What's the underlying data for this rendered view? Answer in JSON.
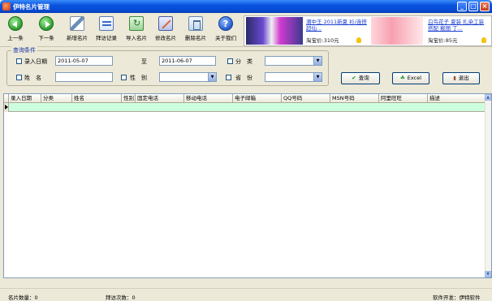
{
  "window": {
    "title": "伊特名片管理"
  },
  "toolbar": {
    "buttons": [
      {
        "label": "上一条",
        "icon": "arrow-left-icon"
      },
      {
        "label": "下一条",
        "icon": "arrow-right-icon"
      },
      {
        "label": "新增名片",
        "icon": "add-card-icon"
      },
      {
        "label": "拜访记录",
        "icon": "visit-record-icon"
      },
      {
        "label": "导入名片",
        "icon": "import-icon"
      },
      {
        "label": "修改名片",
        "icon": "edit-icon"
      },
      {
        "label": "删除名片",
        "icon": "delete-icon"
      },
      {
        "label": "关于我们",
        "icon": "help-icon"
      }
    ]
  },
  "ad": {
    "item1_desc": "潮中王 2011新夏 衫/连搭 超仙...",
    "item1_price": "淘宝价:310元",
    "item2_desc": "白鸟花子 夏装 扎染工装 搭配 靓丽 丁...",
    "item2_price": "淘宝价:85元"
  },
  "query": {
    "group_title": "查询条件",
    "entry_date_label": "录入日期",
    "date_from": "2011-05-07",
    "to_label": "至",
    "date_to": "2011-06-07",
    "category_label": "分　类",
    "name_label": "姓　名",
    "name_value": "",
    "gender_label": "性　别",
    "province_label": "省　份",
    "search_button": "查询",
    "excel_button": "Excel",
    "exit_button": "退出"
  },
  "grid": {
    "columns": [
      "录入日期",
      "分类",
      "姓名",
      "性别",
      "固定电话",
      "移动电话",
      "电子邮箱",
      "QQ号码",
      "MSN号码",
      "阿里旺旺",
      "描述"
    ]
  },
  "status": {
    "card_count": "名片数量：0",
    "visit_count": "拜访次数：0",
    "developer": "软件开发：伊特软件"
  },
  "colors": {
    "title_bar": "#0a54e0",
    "window_bg": "#ece9d8",
    "grid_row": "#ccffdd"
  }
}
